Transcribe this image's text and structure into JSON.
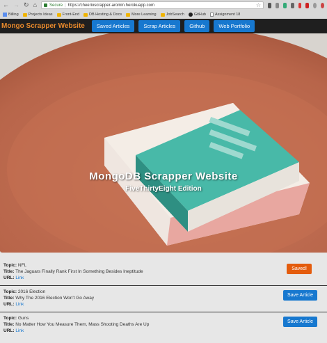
{
  "browser": {
    "secure_label": "Secure",
    "url": "https://cheerioscrapper-aromin.herokuapp.com",
    "bookmarks": [
      "Billing",
      "Projects Ideas",
      "Front-End",
      "DB Hosting & Docs",
      "More Learning",
      "JobSearch",
      "GitHub",
      "Assignment 18"
    ]
  },
  "navbar": {
    "brand": "Mongo Scrapper Website",
    "links": [
      "Saved Articles",
      "Scrap Articles",
      "Github",
      "Web Portfolio"
    ]
  },
  "hero": {
    "title": "MongoDB Scrapper Website",
    "subtitle": "FiveThirtyEight Edition"
  },
  "labels": {
    "topic": "Topic:",
    "title": "Title:",
    "url": "URL:",
    "link": "Link"
  },
  "articles": [
    {
      "topic": "NFL",
      "title": "The Jaguars Finally Rank First In Something Besides Ineptitude",
      "action": "Saved!"
    },
    {
      "topic": "2016 Election",
      "title": "Why The 2016 Election Won't Go Away",
      "action": "Save Article"
    },
    {
      "topic": "Guns",
      "title": "No Matter How You Measure Them, Mass Shooting Deaths Are Up",
      "action": "Save Article"
    }
  ],
  "colors": {
    "brand": "#e98a2c",
    "primary": "#1778cf",
    "saved": "#e45c0d",
    "navbar": "#1f1f1f"
  }
}
